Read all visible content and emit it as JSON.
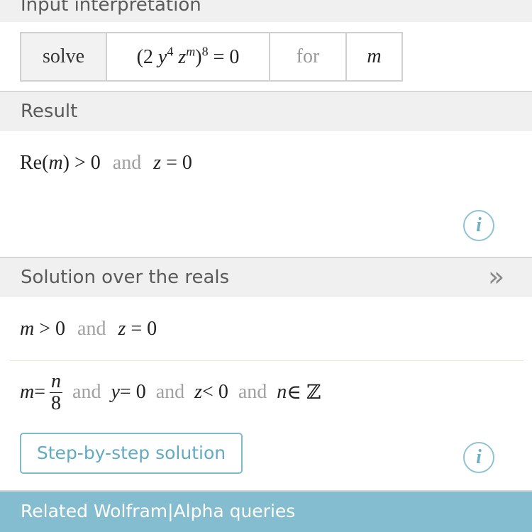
{
  "input_section": {
    "header": "Input interpretation",
    "cells": {
      "solve": "solve",
      "equation": {
        "open": "(2 ",
        "y": "y",
        "y_exp": "4",
        "z": " z",
        "z_exp": "m",
        "close": ")",
        "outer_exp": "8",
        "rhs": " = 0"
      },
      "for": "for",
      "variable": "m"
    }
  },
  "result_section": {
    "header": "Result",
    "expr": {
      "part1": "Re(",
      "var": "m",
      "part2": ") > 0",
      "and": "and",
      "z": "z",
      "part3": " = 0"
    },
    "info": "i"
  },
  "reals_section": {
    "header": "Solution over the reals",
    "more_icon": "»",
    "line1": {
      "m": "m",
      "cond": " > 0",
      "and": "and",
      "z": "z",
      "cond2": " = 0"
    },
    "line2": {
      "m": "m",
      "eq": " =",
      "num": "n",
      "den": "8",
      "and1": "and",
      "y": "y",
      "cond1": " = 0",
      "and2": "and",
      "z": "z",
      "cond2": " < 0",
      "and3": "and",
      "n": "n",
      "cond3": " ∈ ℤ"
    },
    "step_button": "Step-by-step solution",
    "info": "i"
  },
  "footer": {
    "label": "Related Wolfram|Alpha queries"
  },
  "colors": {
    "header_bg": "#f0f0f0",
    "footer_bg": "#85bdd0",
    "accent": "#62a9c3",
    "and_text": "#a0a0a0"
  }
}
